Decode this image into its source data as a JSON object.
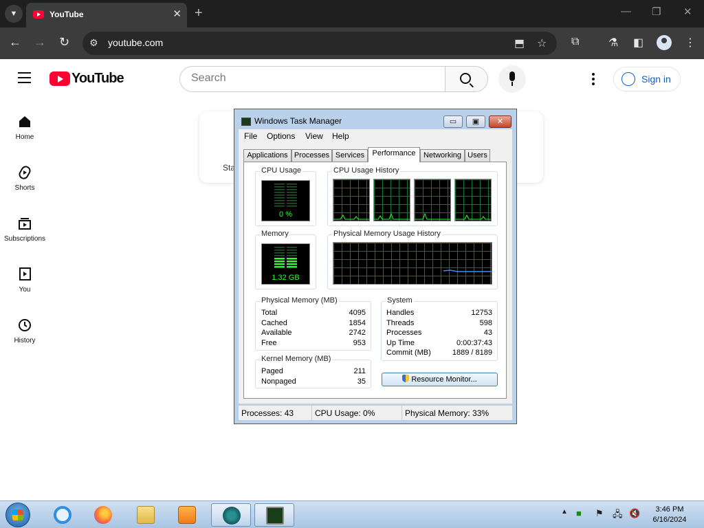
{
  "browser": {
    "tab_title": "YouTube",
    "url": "youtube.com"
  },
  "youtube": {
    "logo_text": "YouTube",
    "search_placeholder": "Search",
    "sign_in_label": "Sign in",
    "sidebar": [
      {
        "label": "Home",
        "icon": "home-icon"
      },
      {
        "label": "Shorts",
        "icon": "shorts-icon"
      },
      {
        "label": "Subscriptions",
        "icon": "subscriptions-icon"
      },
      {
        "label": "You",
        "icon": "you-icon"
      },
      {
        "label": "History",
        "icon": "history-icon"
      }
    ],
    "partial_card_text": "Sta"
  },
  "task_manager": {
    "title": "Windows Task Manager",
    "menus": [
      "File",
      "Options",
      "View",
      "Help"
    ],
    "tabs": [
      "Applications",
      "Processes",
      "Services",
      "Performance",
      "Networking",
      "Users"
    ],
    "active_tab": "Performance",
    "cpu_usage_label": "CPU Usage",
    "cpu_usage_value": "0 %",
    "cpu_history_label": "CPU Usage History",
    "memory_label": "Memory",
    "memory_value": "1.32 GB",
    "memory_history_label": "Physical Memory Usage History",
    "physical_memory": {
      "label": "Physical Memory (MB)",
      "rows": [
        {
          "name": "Total",
          "value": "4095"
        },
        {
          "name": "Cached",
          "value": "1854"
        },
        {
          "name": "Available",
          "value": "2742"
        },
        {
          "name": "Free",
          "value": "953"
        }
      ]
    },
    "kernel_memory": {
      "label": "Kernel Memory (MB)",
      "rows": [
        {
          "name": "Paged",
          "value": "211"
        },
        {
          "name": "Nonpaged",
          "value": "35"
        }
      ]
    },
    "system": {
      "label": "System",
      "rows": [
        {
          "name": "Handles",
          "value": "12753"
        },
        {
          "name": "Threads",
          "value": "598"
        },
        {
          "name": "Processes",
          "value": "43"
        },
        {
          "name": "Up Time",
          "value": "0:00:37:43"
        },
        {
          "name": "Commit (MB)",
          "value": "1889 / 8189"
        }
      ]
    },
    "resource_monitor_label": "Resource Monitor...",
    "status": {
      "processes": "Processes: 43",
      "cpu": "CPU Usage: 0%",
      "memory": "Physical Memory: 33%"
    }
  },
  "taskbar": {
    "clock_time": "3:46 PM",
    "clock_date": "6/16/2024"
  },
  "colors": {
    "youtube_red": "#ff0033",
    "link_blue": "#065fd4",
    "graph_green": "#2eff2e",
    "graph_grid": "#0a7a3a",
    "window_frame": "#b9d1ea"
  }
}
